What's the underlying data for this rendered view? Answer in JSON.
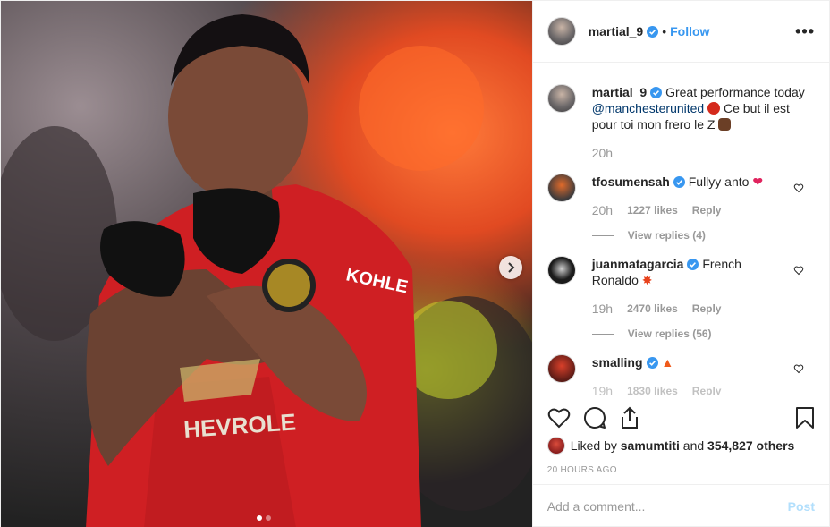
{
  "author": {
    "username": "martial_9",
    "follow_label": "Follow",
    "separator": "•",
    "more_label": "•••"
  },
  "caption": {
    "username": "martial_9",
    "text_before": "Great performance today",
    "mention": "@manchesterunited",
    "text_after": "Ce but il est pour toi mon frero le Z",
    "time": "20h"
  },
  "comments": [
    {
      "username": "tfosumensah",
      "text": "Fullyy anto",
      "emoji": "red-heart",
      "time": "20h",
      "likes": "1227 likes",
      "reply_label": "Reply",
      "view_replies": "View replies (4)"
    },
    {
      "username": "juanmatagarcia",
      "text": "French Ronaldo",
      "emoji": "collision",
      "time": "19h",
      "likes": "2470 likes",
      "reply_label": "Reply",
      "view_replies": "View replies (56)"
    },
    {
      "username": "smalling",
      "text": "",
      "emoji": "fire",
      "time": "19h",
      "likes": "1830 likes",
      "reply_label": "Reply"
    }
  ],
  "likes": {
    "prefix": "Liked by",
    "user": "samumtiti",
    "and": "and",
    "others": "354,827 others"
  },
  "timestamp": "20 hours ago",
  "add_comment": {
    "placeholder": "Add a comment...",
    "post_label": "Post"
  },
  "colors": {
    "link": "#3897f0",
    "verified": "#3897f0",
    "muted": "#999999",
    "text": "#262626"
  },
  "media": {
    "image_subject": "player-celebrating",
    "jersey_sponsor": "CHEVROLET",
    "sleeve_sponsor": "KOHLER",
    "carousel_dots": 2,
    "active_dot": 1
  }
}
